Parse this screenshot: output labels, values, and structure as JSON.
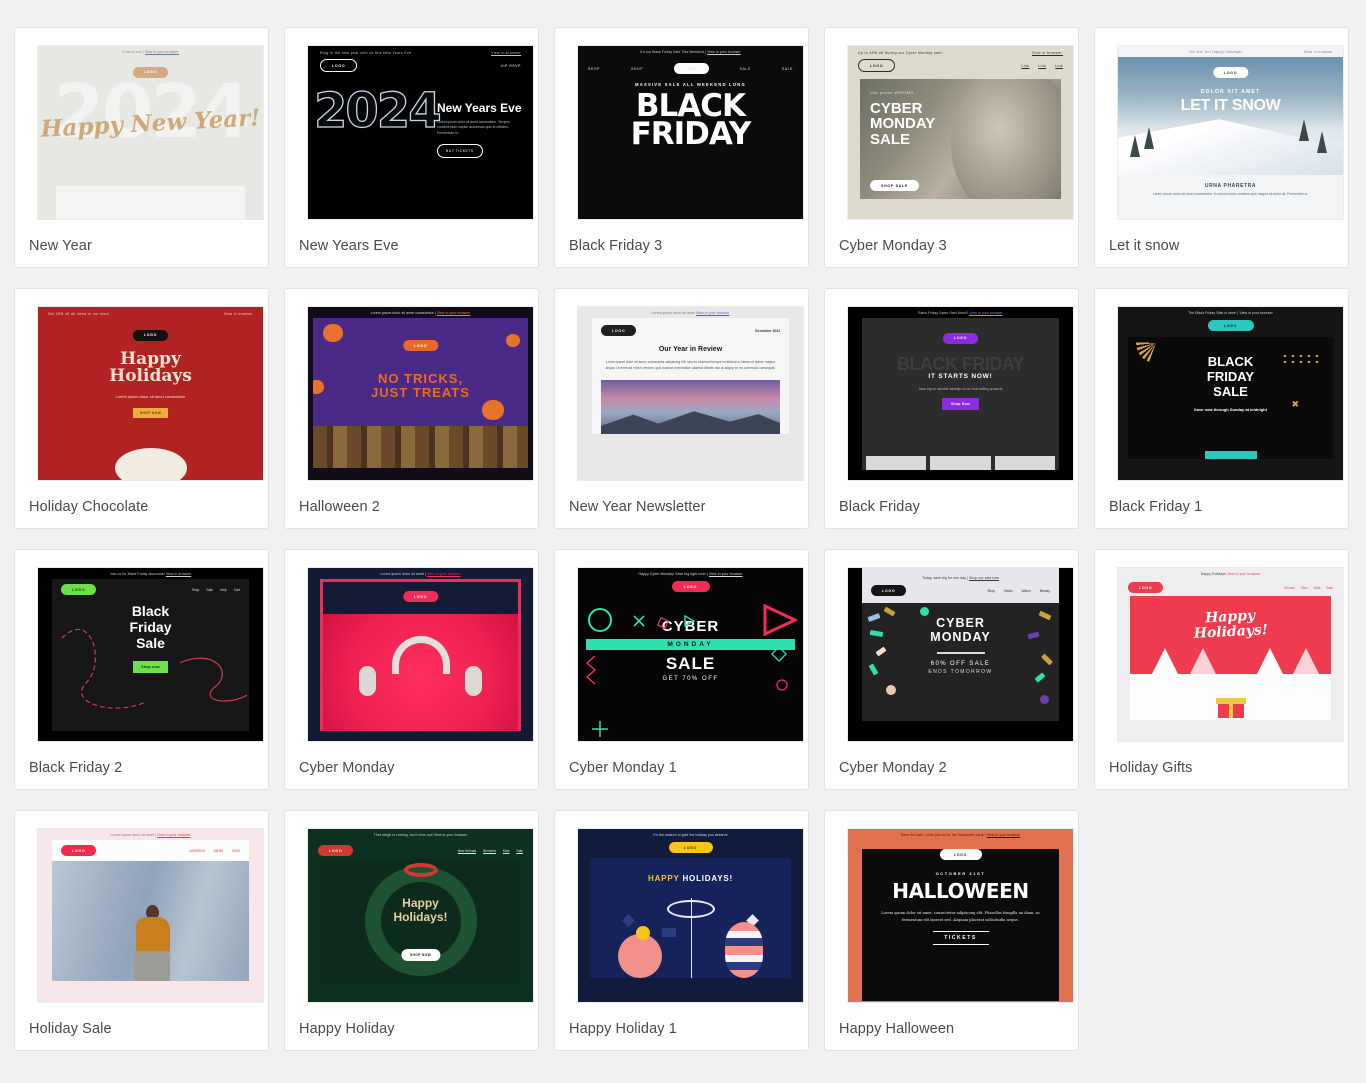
{
  "gallery": {
    "columns": 5,
    "cards": [
      {
        "title": "New Year",
        "preview": {
          "preheader_text": "It has to end | ",
          "preheader_link": "View in your browser.",
          "logo": "LOGO",
          "year": "2024",
          "headline": "Happy New Year!"
        }
      },
      {
        "title": "New Years Eve",
        "preview": {
          "preheader_text": "Ring in the new year with us this New Years Eve",
          "preheader_link": "View in browser",
          "logo": "LOGO",
          "vip": "VIP RSVP",
          "year": "2024",
          "headline": "New Years Eve",
          "body": "Lorem ipsum dolor sit amet consectetur. Tempus condimentum sapien accumsan quis id ultricies. Fermentum in.",
          "cta": "BUY TICKETS"
        }
      },
      {
        "title": "Black Friday 3",
        "preview": {
          "preheader_text": "It's our Black Friday Sale This Weekend | ",
          "preheader_link": "View in your browser",
          "nav": [
            "SHOP",
            "SHOP",
            "SALE",
            "SALE"
          ],
          "logo": "LOGO",
          "kicker": "MASSIVE SALE ALL WEEKEND LONG",
          "headline_line1": "BLACK",
          "headline_line2": "FRIDAY"
        }
      },
      {
        "title": "Cyber Monday 3",
        "preview": {
          "preheader_text": "Up to 40% off during our Cyber Monday sale!",
          "preheader_link": "View in browser.",
          "logo": "LOGO",
          "nav": [
            "Link",
            "Link",
            "Link"
          ],
          "kicker": "Use promo #PROMO",
          "headline_line1": "CYBER",
          "headline_line2": "MONDAY",
          "headline_line3": "SALE",
          "cta": "SHOP SALE"
        }
      },
      {
        "title": "Let it snow",
        "preview": {
          "preheader_text": "Ho! Ho! Ho! Happy Holidays!",
          "preheader_link": "View in browser",
          "logo": "LOGO",
          "kicker": "DOLOR SIT AMET",
          "headline": "LET IT SNOW",
          "section_title": "URNA PHARETRA",
          "section_body": "Lorem ipsum dolor sit amet consectetur. In cursus lorem sodales quis magna sit dolor sit. Fermentum a."
        }
      },
      {
        "title": "Holiday Chocolate",
        "preview": {
          "preheader_text": "Get 20% off all items in our store",
          "preheader_link": "View in browser",
          "logo": "LOGO",
          "headline_line1": "Happy",
          "headline_line2": "Holidays",
          "body": "Lorem ipsum dolor sit amet consectetur",
          "cta": "SHOP NOW"
        }
      },
      {
        "title": "Halloween 2",
        "preview": {
          "preheader_text": "Lorem ipsum dolor sit amet consectetur | ",
          "preheader_link": "View in your browser",
          "logo": "LOGO",
          "headline_line1": "NO TRICKS,",
          "headline_line2": "JUST TREATS"
        }
      },
      {
        "title": "New Year Newsletter",
        "preview": {
          "preheader_text": "Lorem ipsum dolor sit amet  ",
          "preheader_link": "View in your browser",
          "logo": "LOGO",
          "date": "December 2024",
          "headline": "Our Year in Review",
          "body": "Lorem ipsum dolor sit amet, consectetur adipiscing elit, sed do eiusmod tempor incididunt ut labore et dolore magna aliqua. Ut enim ad minim veniam, quis nostrud exercitation ullamco laboris nisi ut aliquip ex ea commodo consequat."
        }
      },
      {
        "title": "Black Friday",
        "preview": {
          "preheader_text": "Black Friday Sales Start Now!!! ",
          "preheader_link": "View in your browser",
          "logo": "LOGO",
          "ghost": "BLACK FRIDAY",
          "headline": "IT STARTS NOW!",
          "body": "Save big on sitewide savings on our best-selling products",
          "cta": "Shop Now"
        }
      },
      {
        "title": "Black Friday 1",
        "preview": {
          "preheader_text": "The Black Friday Sale is here! | ",
          "preheader_link": "View in your browser",
          "logo": "LOGO",
          "headline_line1": "BLACK",
          "headline_line2": "FRIDAY",
          "headline_line3": "SALE",
          "note": "Save now through Sunday at midnight"
        }
      },
      {
        "title": "Black Friday 2",
        "preview": {
          "preheader_text": "Join us for Black Friday discounts! ",
          "preheader_link": "View in browser",
          "logo": "LOGO",
          "nav": [
            "Shop",
            "Sale",
            "Help",
            "Cart"
          ],
          "headline_line1": "Black",
          "headline_line2": "Friday",
          "headline_line3": "Sale",
          "cta": "Shop now"
        }
      },
      {
        "title": "Cyber Monday",
        "preview": {
          "preheader_text": "Lorem ipsum dolor sit amet | ",
          "preheader_link": "View in your browser",
          "logo": "LOGO"
        }
      },
      {
        "title": "Cyber Monday 1",
        "preview": {
          "preheader_text": "Happy Cyber Monday! Save big right now! | ",
          "preheader_link": "View in your browser",
          "logo": "LOGO",
          "headline": "CYBER",
          "band": "MONDAY",
          "sale": "SALE",
          "offer": "GET 70% OFF"
        }
      },
      {
        "title": "Cyber Monday 2",
        "preview": {
          "preheader_text": "Today, save big for one day | ",
          "preheader_link": "Shop our sale now",
          "logo": "LOGO",
          "nav": [
            "Shop",
            "Deals",
            "Watch",
            "Beauty"
          ],
          "headline_line1": "CYBER",
          "headline_line2": "MONDAY",
          "offer": "60% OFF SALE",
          "ends": "ENDS TOMORROW"
        }
      },
      {
        "title": "Holiday Gifts",
        "preview": {
          "preheader_text": "Happy Holidays  ",
          "preheader_link": "View in your browser",
          "logo": "LOGO",
          "nav": [
            "Women",
            "Men",
            "Gifts",
            "Sale"
          ],
          "headline_line1": "Happy",
          "headline_line2": "Holidays!"
        }
      },
      {
        "title": "Holiday Sale",
        "preview": {
          "preheader_text": "Lorem ipsum dolor sit amet | ",
          "preheader_link": "View in your browser",
          "logo": "LOGO",
          "nav": [
            "WOMENS",
            "MENS",
            "KIDS"
          ]
        }
      },
      {
        "title": "Happy Holiday",
        "preview": {
          "preheader_text": "That sleigh is coming, don't miss out! ",
          "preheader_link": "View in your browser",
          "logo": "LOGO",
          "nav": [
            "New Arrivals",
            "Womens",
            "Kids",
            "Sale"
          ],
          "headline_line1": "Happy",
          "headline_line2": "Holidays!",
          "cta": "SHOP NOW"
        }
      },
      {
        "title": "Happy Holiday 1",
        "preview": {
          "preheader_text": "It's the season to give the holiday you deserve",
          "preheader_link": "",
          "logo": "LOGO",
          "headline_accent": "HAPPY",
          "headline_rest": "HOLIDAYS!"
        }
      },
      {
        "title": "Happy Halloween",
        "preview": {
          "preheader_text": "Save the date, come join us for the Halloween party | ",
          "preheader_link": "View in your browser",
          "logo": "LOGO",
          "date": "OCTOBER 31ST",
          "headline": "HALLOWEEN",
          "body": "Lorem ipsum dolor sit amet, consectetur adipiscing elit. Phasellus fringilla mi diam, ac fermentum elit laoreet sed. Aliquam placerat sollicitudin neque.",
          "cta": "TICKETS"
        }
      }
    ]
  },
  "colors": {
    "page_background": "#f1f1f1",
    "card_background": "#ffffff",
    "card_border": "#e3e3e3",
    "title_text": "#4a4a4a"
  }
}
